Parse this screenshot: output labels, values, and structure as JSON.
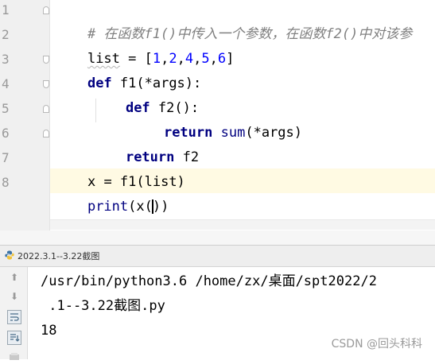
{
  "editor": {
    "line_numbers": [
      "1",
      "2",
      "3",
      "4",
      "5",
      "6",
      "7",
      "8"
    ],
    "lines": {
      "l1": {
        "comment": "# 在函数f1()中传入一个参数，在函数f2()中对该参"
      },
      "l2": {
        "var": "list",
        "eq": " = [",
        "n1": "1",
        "c1": ",",
        "n2": "2",
        "c2": ",",
        "n3": "4",
        "c3": ",",
        "n4": "5",
        "c4": ",",
        "n5": "6",
        "end": "]"
      },
      "l3": {
        "kw": "def",
        "rest": " f1(*args):"
      },
      "l4": {
        "kw": "def",
        "rest": " f2():"
      },
      "l5": {
        "kw": "return",
        "fn": "sum",
        "rest": "(*args)"
      },
      "l6": {
        "kw": "return",
        "rest": " f2"
      },
      "l7": {
        "var": "x",
        "rest": " = f1(list)"
      },
      "l8": {
        "fn": "print",
        "before_caret": "(x(",
        "after_caret": "))"
      }
    }
  },
  "run": {
    "tab_label": "2022.3.1--3.22截图",
    "output": [
      "/usr/bin/python3.6 /home/zx/桌面/spt2022/2",
      " .1--3.22截图.py",
      "18"
    ]
  },
  "watermark": "CSDN @回头科科",
  "colors": {
    "keyword": "#000080",
    "number": "#0000ff",
    "comment": "#808080",
    "current_line": "#fffae3"
  }
}
